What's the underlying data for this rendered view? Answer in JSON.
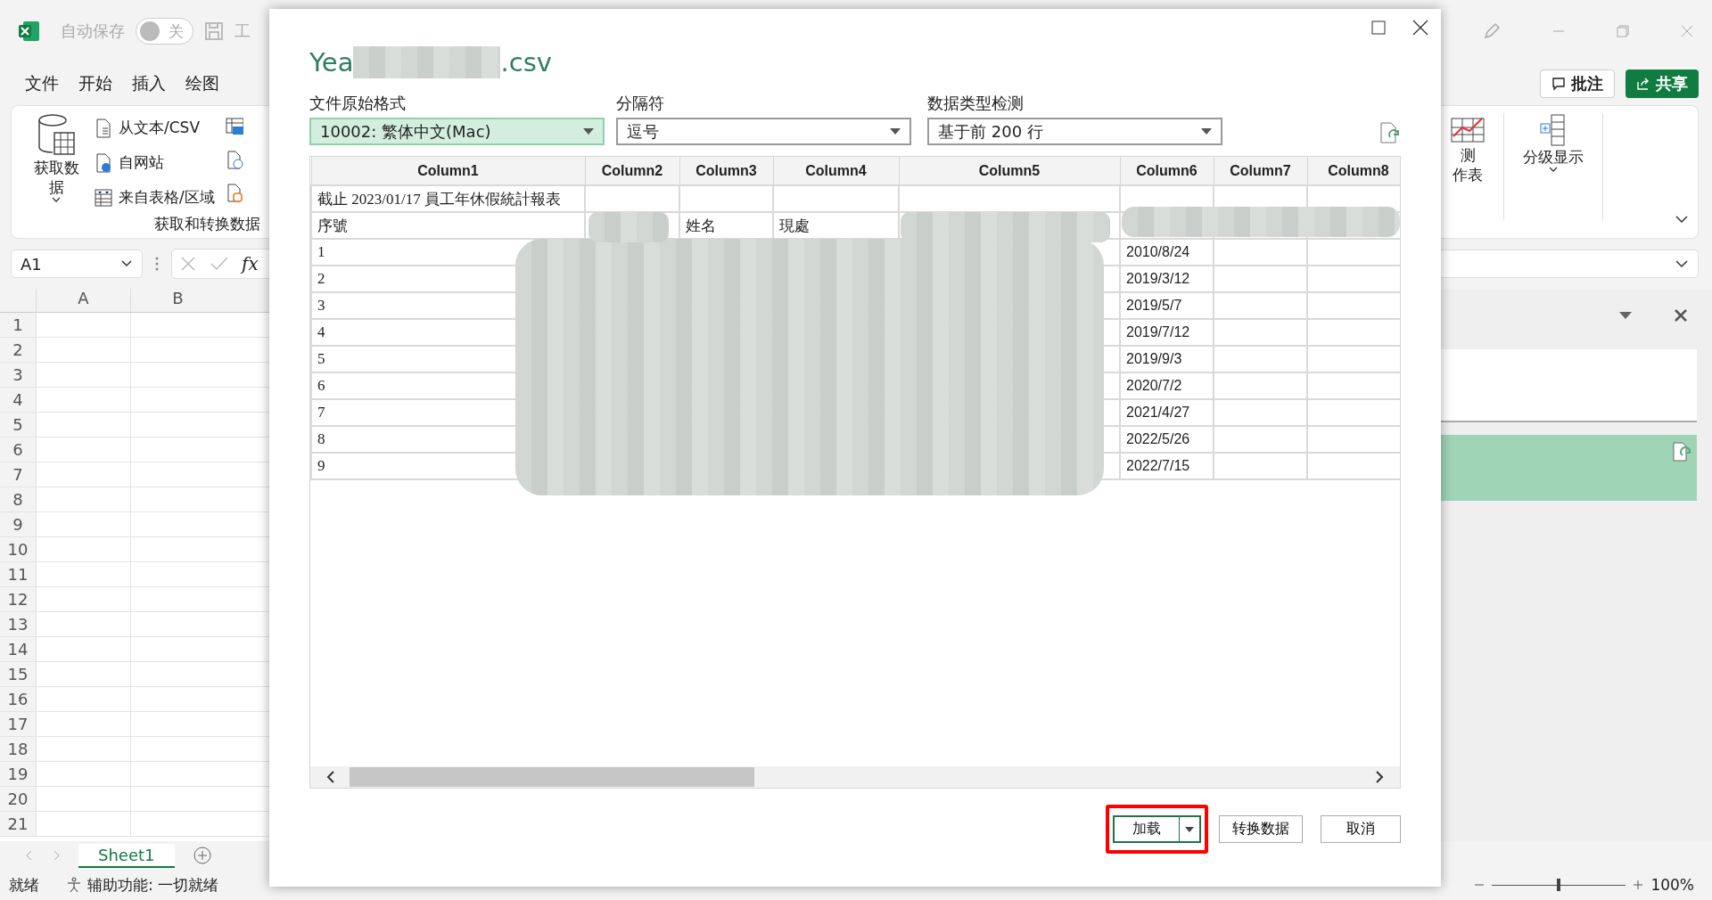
{
  "excel": {
    "autosave": {
      "label": "自动保存",
      "on": false,
      "state_text": "关"
    },
    "title_cut": "工",
    "menu": [
      {
        "label": "文件"
      },
      {
        "label": "开始"
      },
      {
        "label": "插入"
      },
      {
        "label": "绘图"
      }
    ],
    "ribbon_left": {
      "get_data": "获取数据",
      "items": [
        "从文本/CSV",
        "自网站",
        "来自表格/区域"
      ],
      "group_label": "获取和转换数据"
    },
    "comment_button": "批注",
    "share_button": "共享",
    "ribbon_right": {
      "forecast_line1": "测",
      "forecast_line2": "作表",
      "outline": "分级显示"
    },
    "name_box": "A1",
    "function_label": "fx",
    "columns": [
      "A",
      "B"
    ],
    "rows": [
      "1",
      "2",
      "3",
      "4",
      "5",
      "6",
      "7",
      "8",
      "9",
      "10",
      "11",
      "12",
      "13",
      "14",
      "15",
      "16",
      "17",
      "18",
      "19",
      "20",
      "21"
    ],
    "sheets": [
      {
        "label": "Sheet1",
        "selected": true
      }
    ],
    "status": {
      "ready": "就绪",
      "accessibility": "辅助功能: 一切就绪",
      "zoom": "100%",
      "zoom_slider": {
        "level": 0.5
      }
    }
  },
  "dialog": {
    "title_start": "Yea",
    "title_end": ".csv",
    "fields": [
      {
        "label": "文件原始格式",
        "value": "10002: 繁体中文(Mac)",
        "focused": true
      },
      {
        "label": "分隔符",
        "value": "逗号",
        "focused": false
      },
      {
        "label": "数据类型检测",
        "value": "基于前 200 行",
        "focused": false
      }
    ],
    "table": {
      "columns": [
        "Column1",
        "Column2",
        "Column3",
        "Column4",
        "Column5",
        "Column6",
        "Column7",
        "Column8"
      ],
      "rows": [
        [
          "截止 2023/01/17 員工年休假統計報表",
          null,
          null,
          null,
          null,
          null,
          null,
          null
        ],
        [
          "序號",
          null,
          "姓名",
          "現處",
          null,
          null,
          null,
          null
        ],
        [
          "1",
          null,
          null,
          null,
          null,
          "2010/8/24",
          null,
          null
        ],
        [
          "2",
          null,
          null,
          null,
          null,
          "2019/3/12",
          null,
          null
        ],
        [
          "3",
          null,
          null,
          null,
          null,
          "2019/5/7",
          null,
          null
        ],
        [
          "4",
          null,
          null,
          null,
          null,
          "2019/7/12",
          null,
          null
        ],
        [
          "5",
          null,
          null,
          null,
          null,
          "2019/9/3",
          null,
          null
        ],
        [
          "6",
          null,
          null,
          null,
          null,
          "2020/7/2",
          null,
          null
        ],
        [
          "7",
          null,
          null,
          null,
          null,
          "2021/4/27",
          null,
          null
        ],
        [
          "8",
          null,
          null,
          null,
          null,
          "2022/5/26",
          null,
          null
        ],
        [
          "9",
          null,
          null,
          null,
          null,
          "2022/7/15",
          null,
          null
        ]
      ]
    },
    "buttons": [
      {
        "label": "加载",
        "kind": "split",
        "highlighted": true
      },
      {
        "label": "转换数据",
        "kind": "plain",
        "highlighted": false
      },
      {
        "label": "取消",
        "kind": "plain",
        "highlighted": false
      }
    ]
  }
}
